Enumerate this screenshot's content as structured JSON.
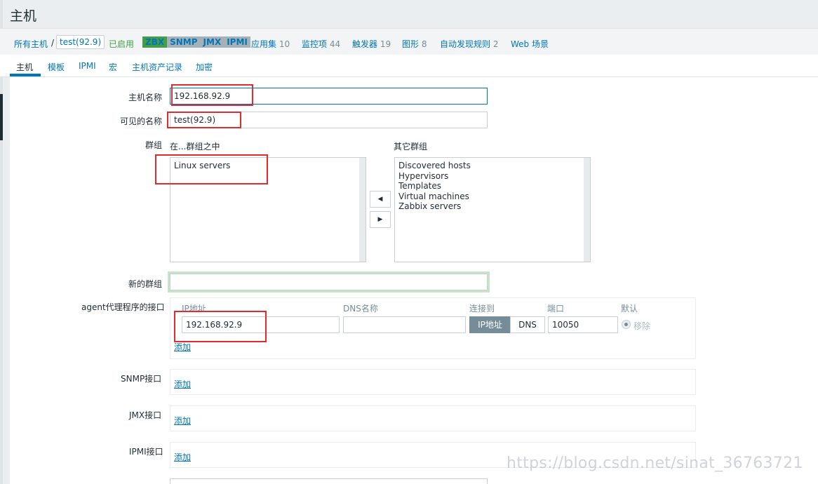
{
  "page": {
    "title": "主机"
  },
  "nav": {
    "all_hosts": "所有主机",
    "separator": "/",
    "current_host": "test(92.9)",
    "status": "已启用",
    "badges": [
      "ZBX",
      "SNMP",
      "JMX",
      "IPMI"
    ],
    "applications_label": "应用集",
    "applications_count": "10",
    "items_label": "监控项",
    "items_count": "44",
    "triggers_label": "触发器",
    "triggers_count": "19",
    "graphs_label": "图形",
    "graphs_count": "8",
    "discovery_label": "自动发现规则",
    "discovery_count": "2",
    "web_label": "Web 场景"
  },
  "tabs": [
    "主机",
    "模板",
    "IPMI",
    "宏",
    "主机资产记录",
    "加密"
  ],
  "form": {
    "host_name_label": "主机名称",
    "host_name_value": "192.168.92.9",
    "visible_name_label": "可见的名称",
    "visible_name_value": "test(92.9)",
    "groups_label": "群组",
    "in_groups_label": "在...群组之中",
    "other_groups_label": "其它群组",
    "in_groups": [
      "Linux servers"
    ],
    "other_groups": [
      "Discovered hosts",
      "Hypervisors",
      "Templates",
      "Virtual machines",
      "Zabbix servers"
    ],
    "new_group_label": "新的群组",
    "new_group_value": "",
    "agent_label": "agent代理程序的接口",
    "agent": {
      "ip_header": "IP地址",
      "dns_header": "DNS名称",
      "connect_header": "连接到",
      "port_header": "端口",
      "default_header": "默认",
      "ip_value": "192.168.92.9",
      "dns_value": "",
      "connect_ip": "IP地址",
      "connect_dns": "DNS",
      "port_value": "10050",
      "remove_label": "移除",
      "add_label": "添加"
    },
    "snmp_label": "SNMP接口",
    "snmp_add": "添加",
    "jmx_label": "JMX接口",
    "jmx_add": "添加",
    "ipmi_label": "IPMI接口",
    "ipmi_add": "添加"
  },
  "watermark": "https://blog.csdn.net/sinat_36763721",
  "colors": {
    "link": "#0275b8",
    "enabled": "#429e47",
    "highlight": "#e02c2c"
  }
}
